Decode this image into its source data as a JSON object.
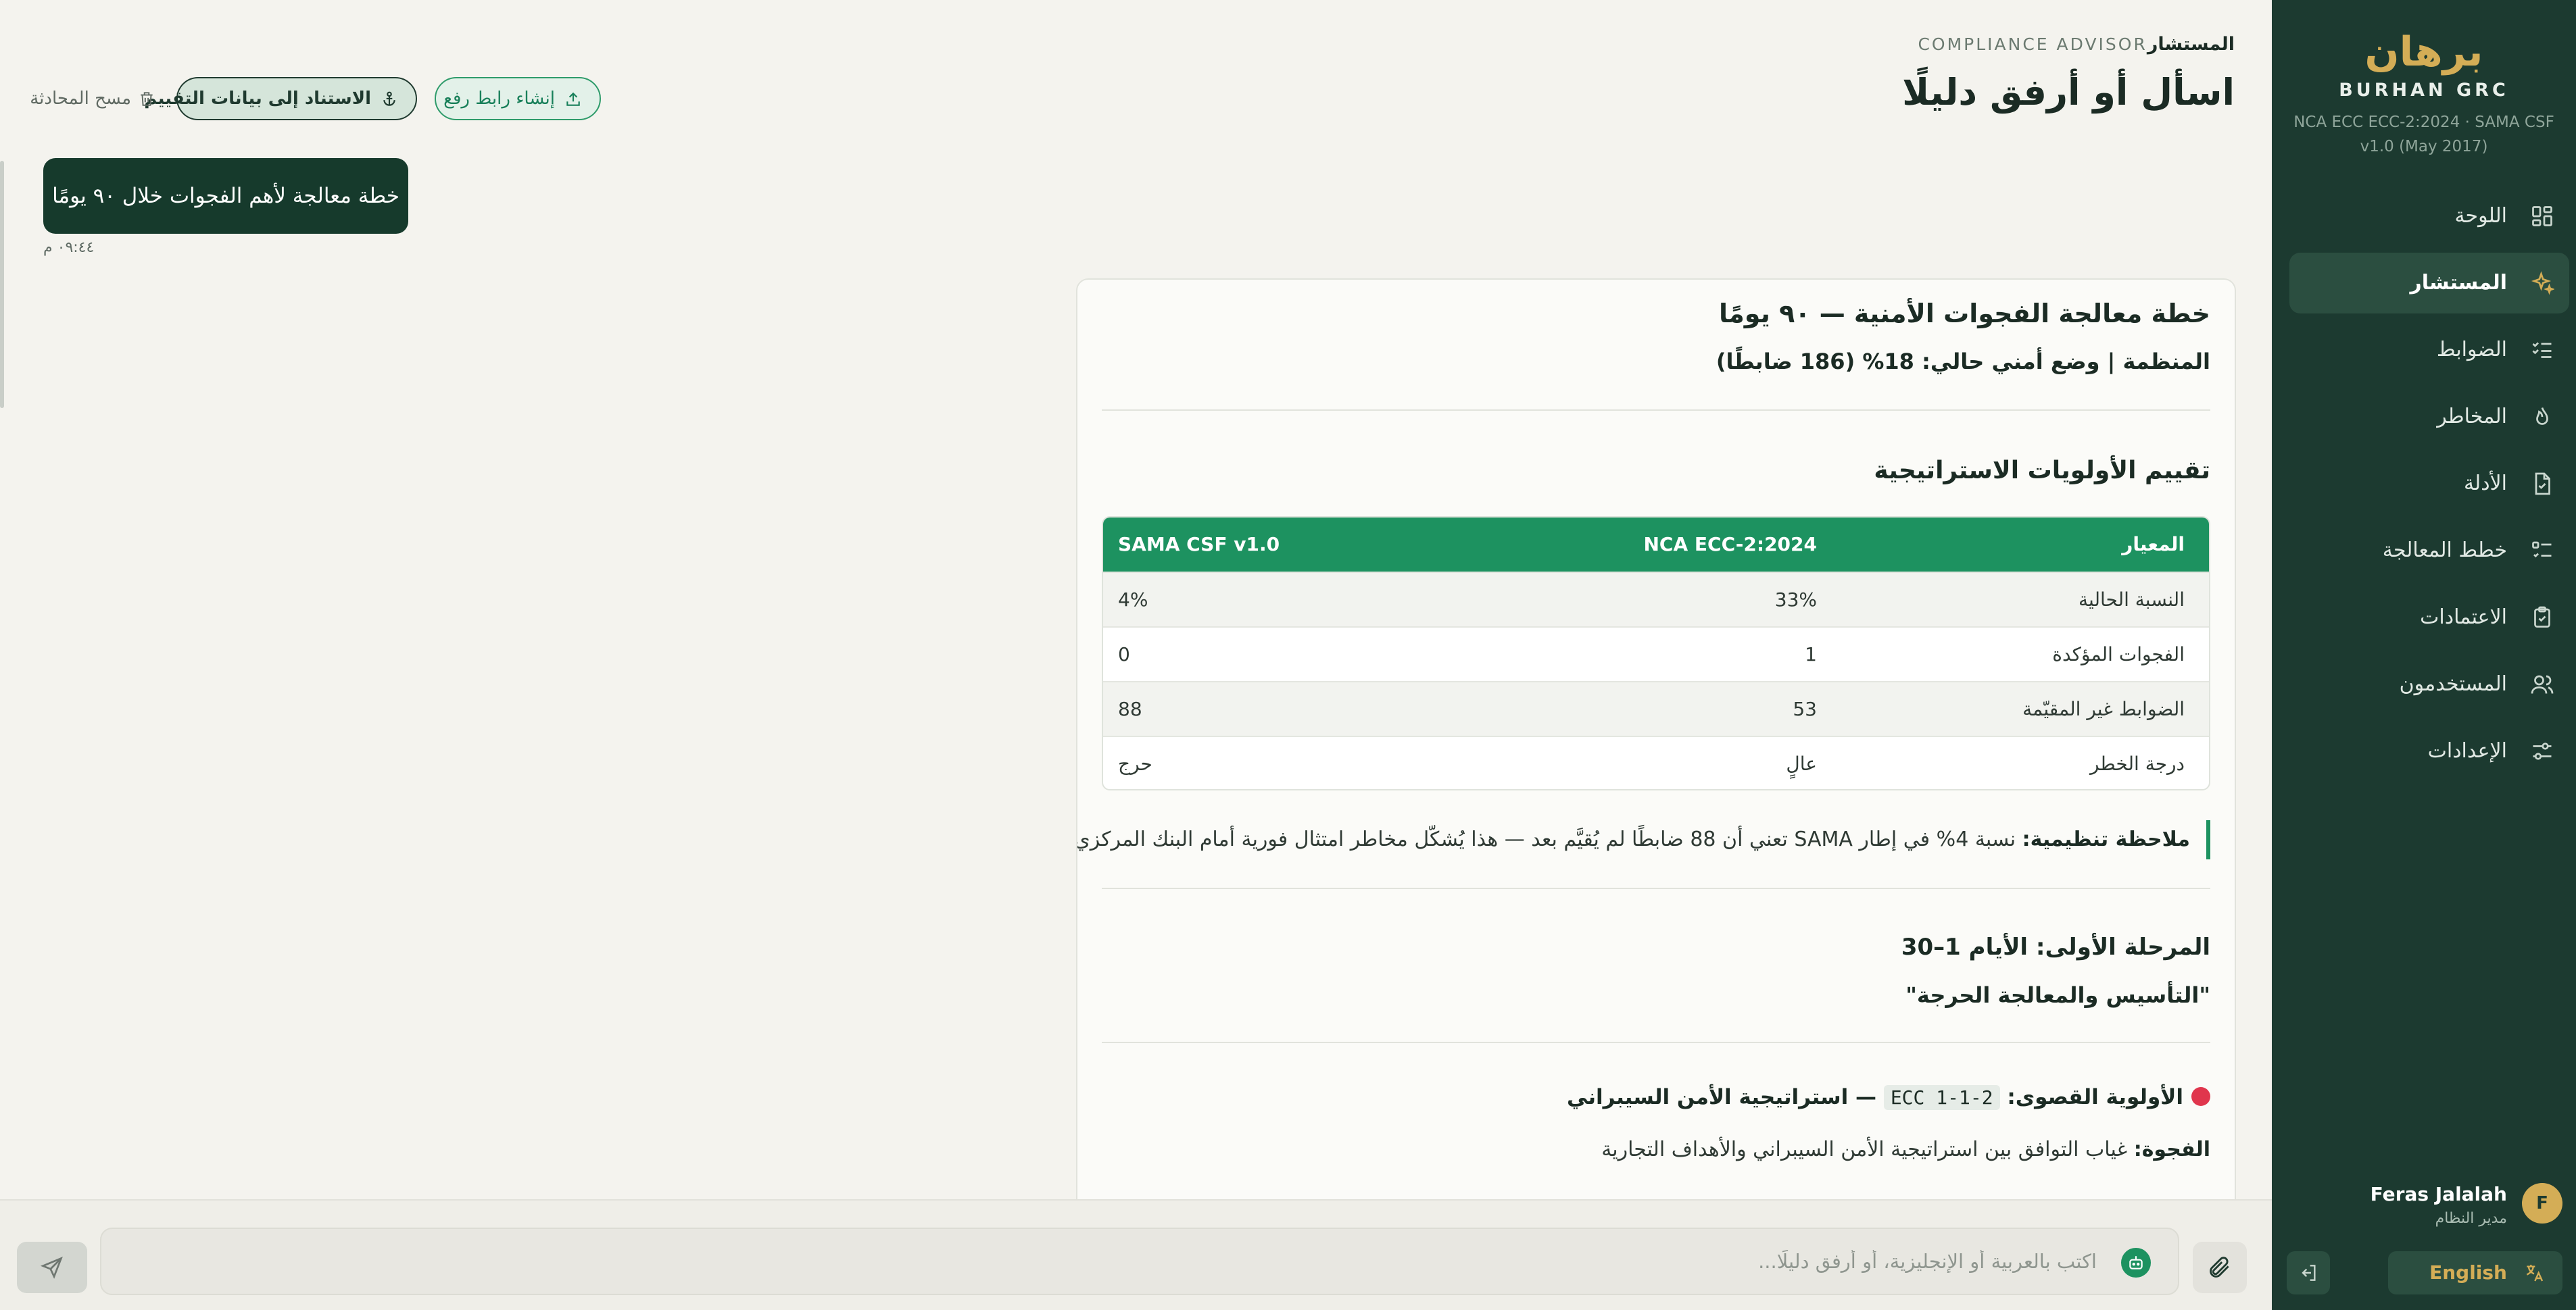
{
  "sidebar": {
    "brand_ar": "برهان",
    "brand_en": "BURHAN GRC",
    "version": "NCA ECC ECC-2:2024 · SAMA CSF v1.0 (May 2017)",
    "items": [
      {
        "label": "اللوحة",
        "icon": "dashboard-icon"
      },
      {
        "label": "المستشار",
        "icon": "sparkles-icon",
        "active": true
      },
      {
        "label": "الضوابط",
        "icon": "checklist-icon"
      },
      {
        "label": "المخاطر",
        "icon": "flame-icon"
      },
      {
        "label": "الأدلة",
        "icon": "file-icon"
      },
      {
        "label": "خطط المعالجة",
        "icon": "list-check-icon"
      },
      {
        "label": "الاعتمادات",
        "icon": "clipboard-check-icon"
      },
      {
        "label": "المستخدمون",
        "icon": "users-icon"
      },
      {
        "label": "الإعدادات",
        "icon": "sliders-icon"
      }
    ],
    "user": {
      "initial": "F",
      "name": "Feras Jalalah",
      "role": "مدير النظام"
    },
    "language_label": "English"
  },
  "header": {
    "eyebrow_ar": "المستشار",
    "eyebrow_en": "COMPLIANCE ADVISOR",
    "title": "اسأل أو أرفق دليلًا",
    "upload_link_label": "إنشاء رابط رفع",
    "anchor_label": "الاستناد إلى بيانات التقييم",
    "clear_label": "مسح المحادثة"
  },
  "chat": {
    "user_message": "خطة معالجة لأهم الفجوات خلال ٩٠ يومًا",
    "user_time": "٠٩:٤٤ م",
    "answer": {
      "title": "خطة معالجة الفجوات الأمنية — ٩٠ يومًا",
      "subtitle": "المنظمة | وضع أمني حالي: 18% (186 ضابطًا)",
      "priorities_title": "تقييم الأولويات الاستراتيجية",
      "table": {
        "headers": [
          "المعيار",
          "NCA ECC-2:2024",
          "SAMA CSF v1.0"
        ],
        "rows": [
          [
            "النسبة الحالية",
            "33%",
            "4%"
          ],
          [
            "الفجوات المؤكدة",
            "1",
            "0"
          ],
          [
            "الضوابط غير المقيّمة",
            "53",
            "88"
          ],
          [
            "درجة الخطر",
            "عالٍ",
            "حرج"
          ]
        ]
      },
      "note_label": "ملاحظة تنظيمية:",
      "note_text": " نسبة 4% في إطار SAMA تعني أن 88 ضابطًا لم يُقيَّم بعد — هذا يُشكّل مخاطر امتثال فورية أمام البنك المركزي السعودي.",
      "phase_title": "المرحلة الأولى: الأيام 1–30",
      "phase_subtitle": "\"التأسيس والمعالجة الحرجة\"",
      "priority_label": "الأولوية القصوى:",
      "priority_code": "ECC 1-1-2",
      "priority_text": "— استراتيجية الأمن السيبراني",
      "gap_label": "الفجوة:",
      "gap_text": " غياب التوافق بين استراتيجية الأمن السيبراني والأهداف التجارية"
    }
  },
  "composer": {
    "placeholder": "اكتب بالعربية أو الإنجليزية، أو أرفق دليلًا..."
  },
  "colors": {
    "sidebar_bg": "#1c3a30",
    "accent_gold": "#d4ad56",
    "accent_green": "#1d9260",
    "user_bubble": "#163a2c",
    "page_bg": "#f4f3ee"
  }
}
